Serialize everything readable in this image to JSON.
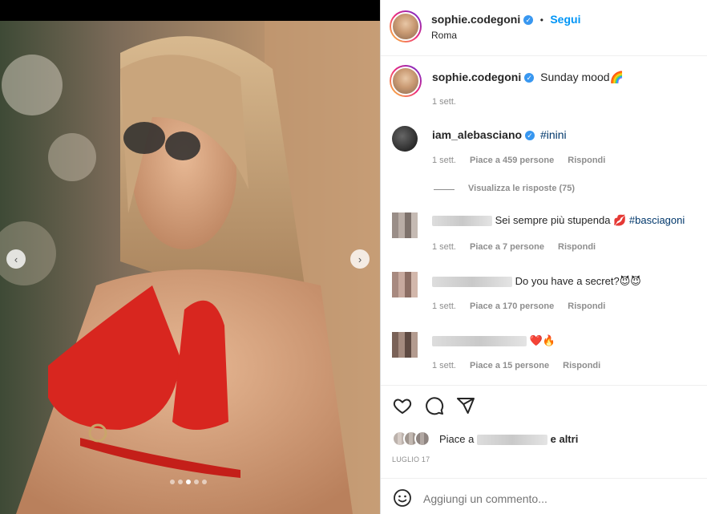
{
  "header": {
    "username": "sophie.codegoni",
    "follow_sep": "•",
    "follow_label": "Segui",
    "location": "Roma"
  },
  "caption": {
    "username": "sophie.codegoni",
    "text": "Sunday mood🌈",
    "time": "1 sett."
  },
  "comments": [
    {
      "username": "iam_alebasciano",
      "verified": true,
      "text": "#inini",
      "time": "1 sett.",
      "likes": "Piace a 459 persone",
      "reply": "Rispondi",
      "view_replies": "Visualizza le risposte (75)"
    },
    {
      "text_plain": "Sei sempre più stupenda 💋",
      "hashtag": "#basciagoni",
      "time": "1 sett.",
      "likes": "Piace a 7 persone",
      "reply": "Rispondi"
    },
    {
      "text": "Do you have a secret?😈😈",
      "time": "1 sett.",
      "likes": "Piace a 170 persone",
      "reply": "Rispondi"
    },
    {
      "text": "❤️🔥",
      "time": "1 sett.",
      "likes": "Piace a 15 persone",
      "reply": "Rispondi"
    }
  ],
  "actions": {
    "like_icon": "heart-icon",
    "comment_icon": "comment-icon",
    "share_icon": "share-icon"
  },
  "likes_summary": {
    "prefix": "Piace a",
    "suffix": "e altri"
  },
  "post_date": "LUGLIO 17",
  "add_comment": {
    "placeholder": "Aggiungi un commento..."
  },
  "carousel": {
    "dots": 5,
    "active_index": 2
  },
  "colors": {
    "accent_blue": "#0095f6",
    "verified_blue": "#3897f0",
    "hashtag": "#00376b",
    "muted": "#8e8e8e"
  }
}
